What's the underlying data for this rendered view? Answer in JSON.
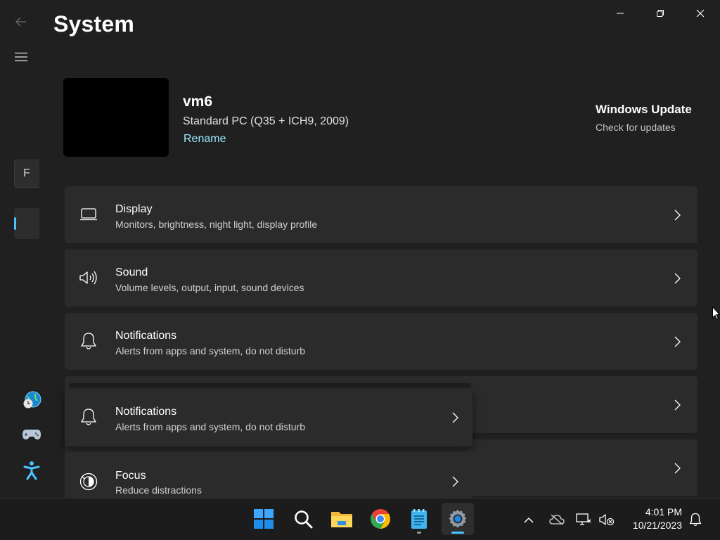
{
  "window": {
    "title": "System",
    "caption": {
      "minimize": "minimize-icon",
      "maximize": "restore-icon",
      "close": "close-icon"
    }
  },
  "nav": {
    "search_stub_letter": "F",
    "accent": "#4cc2ff"
  },
  "device": {
    "name": "vm6",
    "model": "Standard PC (Q35 + ICH9, 2009)",
    "rename_label": "Rename"
  },
  "windows_update": {
    "title": "Windows Update",
    "subtitle": "Check for updates"
  },
  "cards": [
    {
      "title": "Display",
      "subtitle": "Monitors, brightness, night light, display profile",
      "icon": "monitor-icon"
    },
    {
      "title": "Sound",
      "subtitle": "Volume levels, output, input, sound devices",
      "icon": "speaker-icon"
    },
    {
      "title": "Notifications",
      "subtitle": "Alerts from apps and system, do not disturb",
      "icon": "bell-icon"
    }
  ],
  "drag_ghost": {
    "title": "Notifications",
    "subtitle": "Alerts from apps and system, do not disturb",
    "icon": "bell-icon"
  },
  "focus_card": {
    "title": "Focus",
    "subtitle": "Reduce distractions",
    "icon": "focus-icon"
  },
  "taskbar": {
    "apps": [
      "start-icon",
      "search-icon",
      "file-explorer-icon",
      "chrome-icon",
      "notepad-icon",
      "settings-icon"
    ],
    "tray": [
      "chevron-up-icon",
      "onedrive-icon",
      "network-icon",
      "volume-muted-icon"
    ],
    "time": "4:01 PM",
    "date": "10/21/2023"
  }
}
